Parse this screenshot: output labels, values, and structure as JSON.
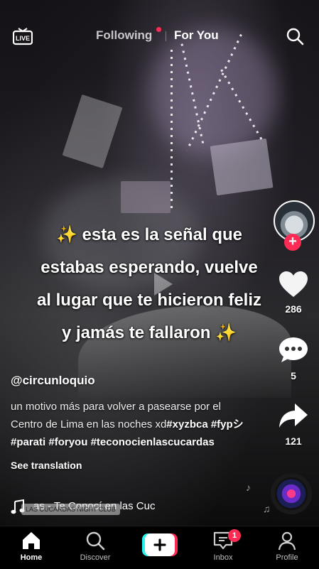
{
  "top_nav": {
    "live_label": "LIVE",
    "following_label": "Following",
    "for_you_label": "For You"
  },
  "video": {
    "caption_lines": [
      "✨ esta es la señal que",
      "estabas esperando, vuelve",
      "al lugar que te hicieron feliz",
      "y jamás te fallaron ✨"
    ],
    "location_sticker": "LAS CUCARDAS NIGHT CLUB"
  },
  "author": {
    "username": "@circunloquio",
    "description_plain": "un motivo más para volver a pasearse por el Centro de Lima en las noches xd",
    "hashtags": [
      "#xyzbca",
      "#fypシ",
      "#parati",
      "#foryou",
      "#teconocienlascucardas"
    ],
    "see_translation": "See translation"
  },
  "music": {
    "text": "as - Te Conocí en las Cuc"
  },
  "actions": {
    "likes": "286",
    "comments": "5",
    "shares": "121"
  },
  "bottom_nav": {
    "home": "Home",
    "discover": "Discover",
    "inbox": "Inbox",
    "inbox_badge": "1",
    "profile": "Profile"
  },
  "colors": {
    "accent": "#fe2c55",
    "create_cyan": "#25f4ee",
    "background": "#000000"
  }
}
